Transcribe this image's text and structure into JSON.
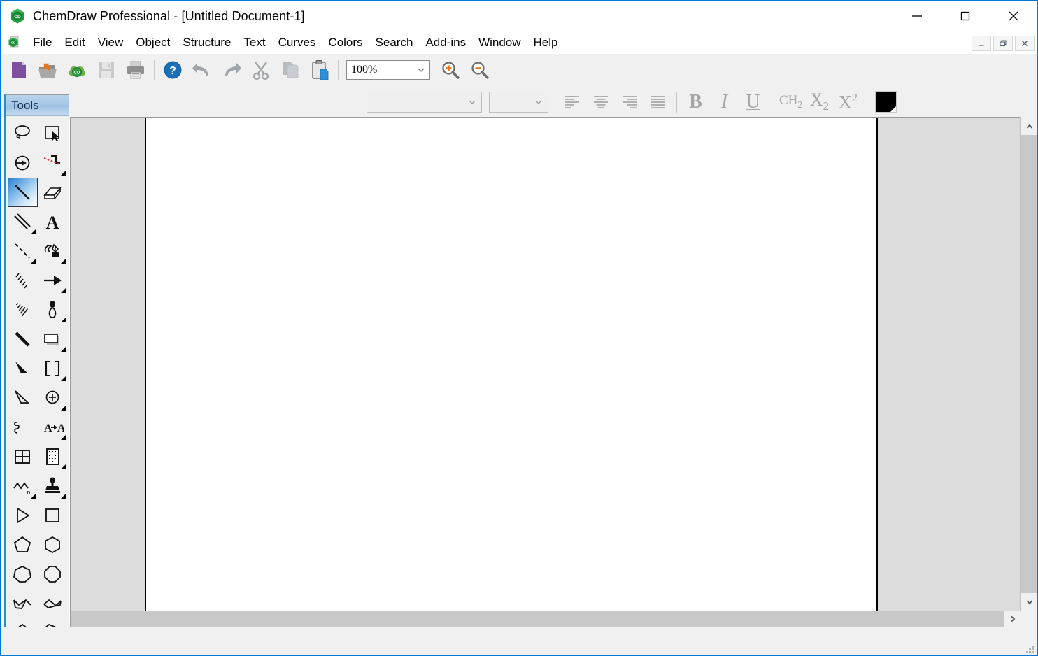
{
  "window": {
    "title": "ChemDraw Professional - [Untitled Document-1]",
    "app_icon": "chemdraw-logo-icon",
    "controls": {
      "minimize": "minimize-icon",
      "maximize": "maximize-icon",
      "close": "close-icon"
    },
    "mdi_controls": {
      "restore_down": "mdi-minimize-icon",
      "restore": "mdi-restore-icon",
      "close": "mdi-close-icon"
    }
  },
  "menubar": {
    "doc_icon": "document-chemdraw-icon",
    "items": [
      {
        "label": "File"
      },
      {
        "label": "Edit"
      },
      {
        "label": "View"
      },
      {
        "label": "Object"
      },
      {
        "label": "Structure"
      },
      {
        "label": "Text"
      },
      {
        "label": "Curves"
      },
      {
        "label": "Colors"
      },
      {
        "label": "Search"
      },
      {
        "label": "Add-ins"
      },
      {
        "label": "Window"
      },
      {
        "label": "Help"
      }
    ]
  },
  "main_toolbar": {
    "buttons": [
      {
        "name": "new-document-button",
        "icon": "new-document-icon",
        "enabled": true
      },
      {
        "name": "open-document-button",
        "icon": "open-folder-icon",
        "enabled": true
      },
      {
        "name": "chemdraw-cloud-button",
        "icon": "chemdraw-cloud-icon",
        "enabled": true
      },
      {
        "name": "save-button",
        "icon": "save-floppy-icon",
        "enabled": false
      },
      {
        "name": "print-button",
        "icon": "printer-icon",
        "enabled": true
      },
      {
        "name": "help-button",
        "icon": "help-question-icon",
        "enabled": true
      },
      {
        "name": "undo-button",
        "icon": "undo-arrow-icon",
        "enabled": false
      },
      {
        "name": "redo-button",
        "icon": "redo-arrow-icon",
        "enabled": false
      },
      {
        "name": "cut-button",
        "icon": "scissors-icon",
        "enabled": false
      },
      {
        "name": "copy-button",
        "icon": "copy-pages-icon",
        "enabled": false
      },
      {
        "name": "paste-button",
        "icon": "clipboard-paste-icon",
        "enabled": true
      }
    ],
    "zoom": {
      "value": "100%",
      "placeholder": "100%",
      "dropdown_icon": "chevron-down-icon",
      "zoom_in_icon": "zoom-in-magnifier-icon",
      "zoom_out_icon": "zoom-out-magnifier-icon"
    }
  },
  "format_toolbar": {
    "font_name": {
      "value": "",
      "placeholder": ""
    },
    "font_size": {
      "value": "",
      "placeholder": ""
    },
    "align_buttons": [
      {
        "name": "align-left-button",
        "icon": "align-left-icon"
      },
      {
        "name": "align-center-button",
        "icon": "align-center-icon"
      },
      {
        "name": "align-right-button",
        "icon": "align-right-icon"
      },
      {
        "name": "align-justify-button",
        "icon": "align-justify-icon"
      }
    ],
    "bold_label": "B",
    "italic_label": "I",
    "underline_label": "U",
    "formula_label": "CH2",
    "subscript_label": "X2",
    "superscript_label": "X2",
    "color_swatch": "#000000"
  },
  "tools_palette": {
    "title": "Tools",
    "selected_tool": "solid-bond-tool",
    "tools": [
      {
        "name": "lasso-select-tool",
        "icon": "lasso-icon",
        "dropdown": false
      },
      {
        "name": "marquee-select-tool",
        "icon": "marquee-select-icon",
        "dropdown": false
      },
      {
        "name": "structure-perspective-tool",
        "icon": "circle-arrow-icon",
        "dropdown": false
      },
      {
        "name": "eraser-path-tool",
        "icon": "red-dashed-bond-icon",
        "dropdown": true
      },
      {
        "name": "solid-bond-tool",
        "icon": "solid-bond-icon",
        "dropdown": false
      },
      {
        "name": "eraser-tool",
        "icon": "eraser-icon",
        "dropdown": false
      },
      {
        "name": "multiple-bond-tool",
        "icon": "double-bond-icon",
        "dropdown": true
      },
      {
        "name": "text-tool",
        "icon": "text-a-icon",
        "dropdown": false
      },
      {
        "name": "dashed-bond-tool",
        "icon": "dashed-bond-icon",
        "dropdown": true
      },
      {
        "name": "pen-tool",
        "icon": "fountain-pen-icon",
        "dropdown": true
      },
      {
        "name": "hashed-bond-tool",
        "icon": "hashed-bond-icon",
        "dropdown": false
      },
      {
        "name": "arrow-tool",
        "icon": "arrow-right-icon",
        "dropdown": true
      },
      {
        "name": "hashed-wedge-bond-tool",
        "icon": "hashed-wedge-icon",
        "dropdown": false
      },
      {
        "name": "orbital-tool",
        "icon": "orbital-icon",
        "dropdown": true
      },
      {
        "name": "bold-bond-tool",
        "icon": "bold-bond-icon",
        "dropdown": false
      },
      {
        "name": "drawing-frame-tool",
        "icon": "rectangle-frame-icon",
        "dropdown": true
      },
      {
        "name": "wedged-bond-tool",
        "icon": "solid-wedge-icon",
        "dropdown": false
      },
      {
        "name": "bracket-tool",
        "icon": "brackets-icon",
        "dropdown": true
      },
      {
        "name": "hollow-wedge-bond-tool",
        "icon": "hollow-wedge-icon",
        "dropdown": false
      },
      {
        "name": "charge-tool",
        "icon": "circle-plus-icon",
        "dropdown": true
      },
      {
        "name": "wavy-bond-tool",
        "icon": "squiggle-bond-icon",
        "dropdown": false
      },
      {
        "name": "name-to-structure-tool",
        "icon": "a-to-a-icon",
        "dropdown": true
      },
      {
        "name": "table-tool",
        "icon": "grid-table-icon",
        "dropdown": false
      },
      {
        "name": "template-tool",
        "icon": "template-page-icon",
        "dropdown": true
      },
      {
        "name": "chain-tool",
        "icon": "chain-n-icon",
        "dropdown": true
      },
      {
        "name": "stamp-tool",
        "icon": "stamp-icon",
        "dropdown": true
      },
      {
        "name": "acyclic-chain-tool",
        "icon": "triangle-outline-icon",
        "dropdown": false
      },
      {
        "name": "cyclobutane-ring-tool",
        "icon": "square-outline-icon",
        "dropdown": false
      },
      {
        "name": "cyclopentane-ring-tool",
        "icon": "pentagon-icon",
        "dropdown": false
      },
      {
        "name": "cyclohexane-ring-tool",
        "icon": "hexagon-icon",
        "dropdown": false
      },
      {
        "name": "cycloheptane-ring-tool",
        "icon": "heptagon-icon",
        "dropdown": false
      },
      {
        "name": "cyclooctane-ring-tool",
        "icon": "octagon-icon",
        "dropdown": false
      },
      {
        "name": "cyclopentadiene-tool",
        "icon": "cyclopentadiene-icon",
        "dropdown": false
      },
      {
        "name": "cyclohexadiene-tool",
        "icon": "cyclohexadiene-icon",
        "dropdown": false
      },
      {
        "name": "cyclopentadienyl-tool",
        "icon": "cyclopentadienyl-ring-icon",
        "dropdown": false
      },
      {
        "name": "benzene-ring-tool",
        "icon": "benzene-ring-icon",
        "dropdown": false
      }
    ]
  },
  "document": {
    "page_background": "#ffffff",
    "canvas_background": "#dcdcdc"
  },
  "scrollbars": {
    "v_up_icon": "chevron-up-icon",
    "v_down_icon": "chevron-down-icon",
    "h_right_icon": "chevron-right-icon"
  },
  "statusbar": {
    "text": "",
    "resize_grip": "resize-grip-icon"
  },
  "colors": {
    "accent_blue": "#0078d7",
    "tools_border_blue": "#2a8ad4",
    "toolbar_bg": "#f0f0f0",
    "canvas_gray": "#dcdcdc"
  }
}
